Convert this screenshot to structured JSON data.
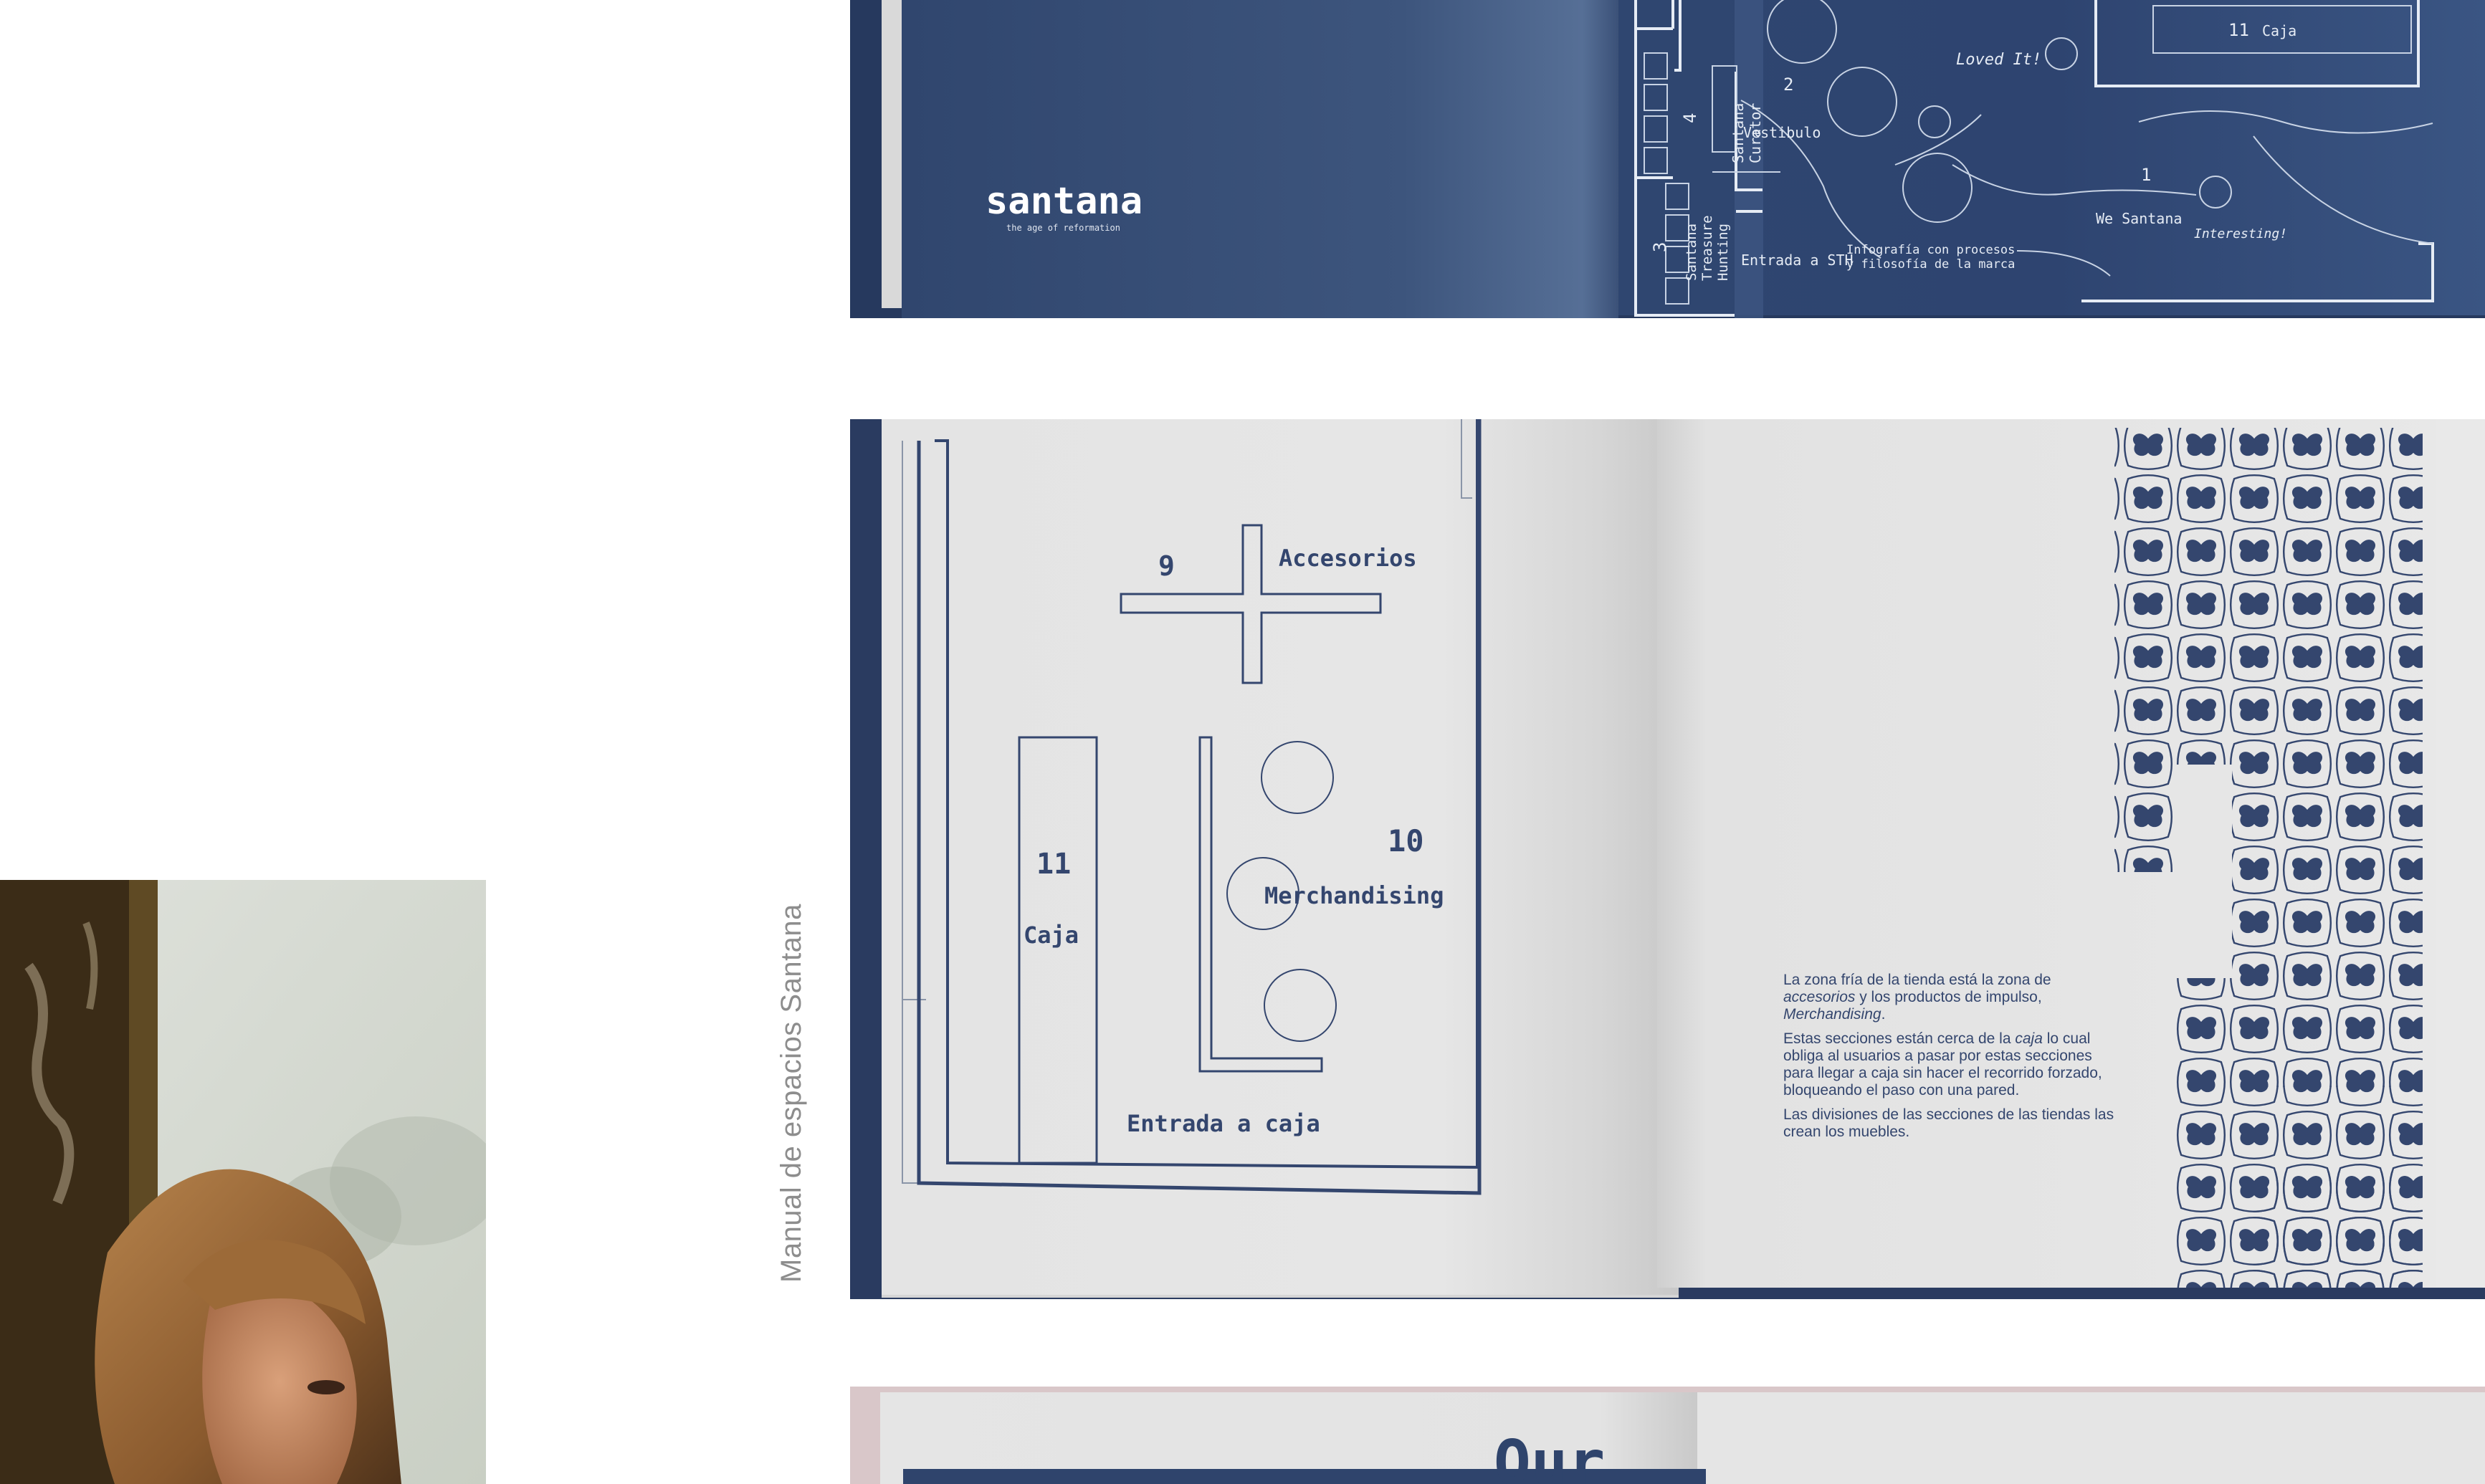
{
  "caption": {
    "vertical": "Manual de espacios Santana"
  },
  "book_top": {
    "cover": {
      "brand": "santana",
      "tagline": "the age of reformation"
    },
    "map_labels": {
      "n11_caja_num": "11",
      "n11_caja_label": "Caja",
      "n2": "2",
      "vestibulo": "Vestibulo",
      "n1": "1",
      "we_santana": "We Santana",
      "interesting": "Interesting!",
      "loved_it": "Loved It!",
      "entrada_sth": "Entrada a STH",
      "entrada_prefix": "Entr",
      "infografia_1": "Infografía con procesos",
      "infografia_2": "y filosofía de la marca",
      "n4": "4",
      "santana_curator_1": "Santana",
      "santana_curator_2": "Curator",
      "n3": "3",
      "treasure_1": "Santana",
      "treasure_2": "Treasure",
      "treasure_3": "Hunting"
    }
  },
  "book_mid": {
    "plan": {
      "n9": "9",
      "accesorios": "Accesorios",
      "n10": "10",
      "merchandising": "Merchandising",
      "n11": "11",
      "caja": "Caja",
      "entrada_caja": "Entrada a caja"
    },
    "text": {
      "p1_a": "La zona fría de la tienda está la zona de ",
      "p1_b": "accesorios",
      "p1_c": " y los productos de impulso, ",
      "p1_d": "Merchandising",
      "p1_e": ".",
      "p2_a": "Estas secciones están cerca de la ",
      "p2_b": "caja",
      "p2_c": " lo cual obliga al usuarios a pasar por estas secciones para llegar a caja sin hacer el recorrido forzado, bloqueando el paso con una pared.",
      "p3": "Las divisiones de las secciones de las tiendas las crean los muebles."
    }
  },
  "book_bottom": {
    "partial_heading": "Our"
  },
  "colors": {
    "navy": "#34466e",
    "navy_dark": "#2a3b60",
    "page": "#e6e6e6",
    "caption": "#8d8d8d",
    "blush": "#d9c7c9"
  }
}
